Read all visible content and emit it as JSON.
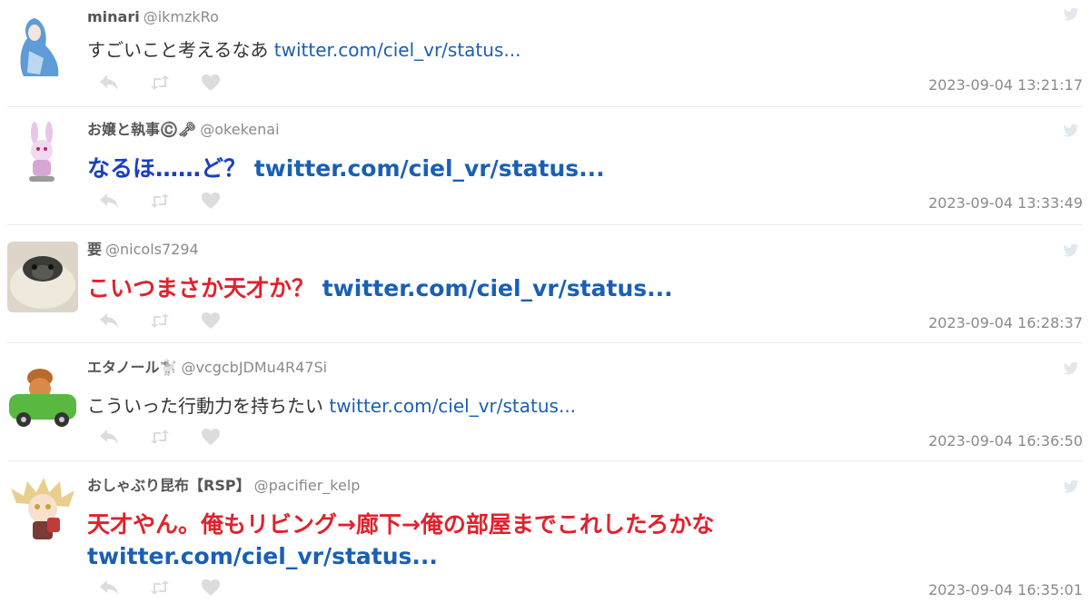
{
  "tweets": [
    {
      "name": "minari",
      "handle": "@ikmzkRo",
      "text": "すごいこと考えるなあ ",
      "link": "twitter.com/ciel_vr/status...",
      "timestamp": "2023-09-04 13:21:17",
      "avatar_icon": "hooded-figure-avatar"
    },
    {
      "name": "お嬢と執事©️🗝",
      "handle": "@okekenai",
      "text": "なるほ……ど？ ",
      "link": "twitter.com/ciel_vr/status...",
      "timestamp": "2023-09-04 13:33:49",
      "avatar_icon": "bunny-avatar"
    },
    {
      "name": "要",
      "handle": "@nicols7294",
      "text": "こいつまさか天才か？ ",
      "link": "twitter.com/ciel_vr/status...",
      "timestamp": "2023-09-04 16:28:37",
      "avatar_icon": "pug-avatar"
    },
    {
      "name": "エタノール🐩",
      "handle": "@vcgcbJDMu4R47Si",
      "text": "こういった行動力を持ちたい ",
      "link": "twitter.com/ciel_vr/status...",
      "timestamp": "2023-09-04 16:36:50",
      "avatar_icon": "car-avatar"
    },
    {
      "name": "おしゃぶり昆布【RSP】",
      "handle": "@pacifier_kelp",
      "text": "天才やん。俺もリビング→廊下→俺の部屋までこれしたろかな",
      "link": "twitter.com/ciel_vr/status...",
      "timestamp": "2023-09-04 16:35:01",
      "avatar_icon": "anime-girl-avatar"
    }
  ],
  "icons": {
    "reply": "reply-icon",
    "retweet": "retweet-icon",
    "like": "heart-icon",
    "source": "twitter-bird-icon"
  },
  "colors": {
    "link": "#1a5fb4",
    "highlight_blue": "#1a3fbf",
    "highlight_red": "#e0222d",
    "muted": "#8a8a8a",
    "action_icon": "#dcdcdc"
  }
}
